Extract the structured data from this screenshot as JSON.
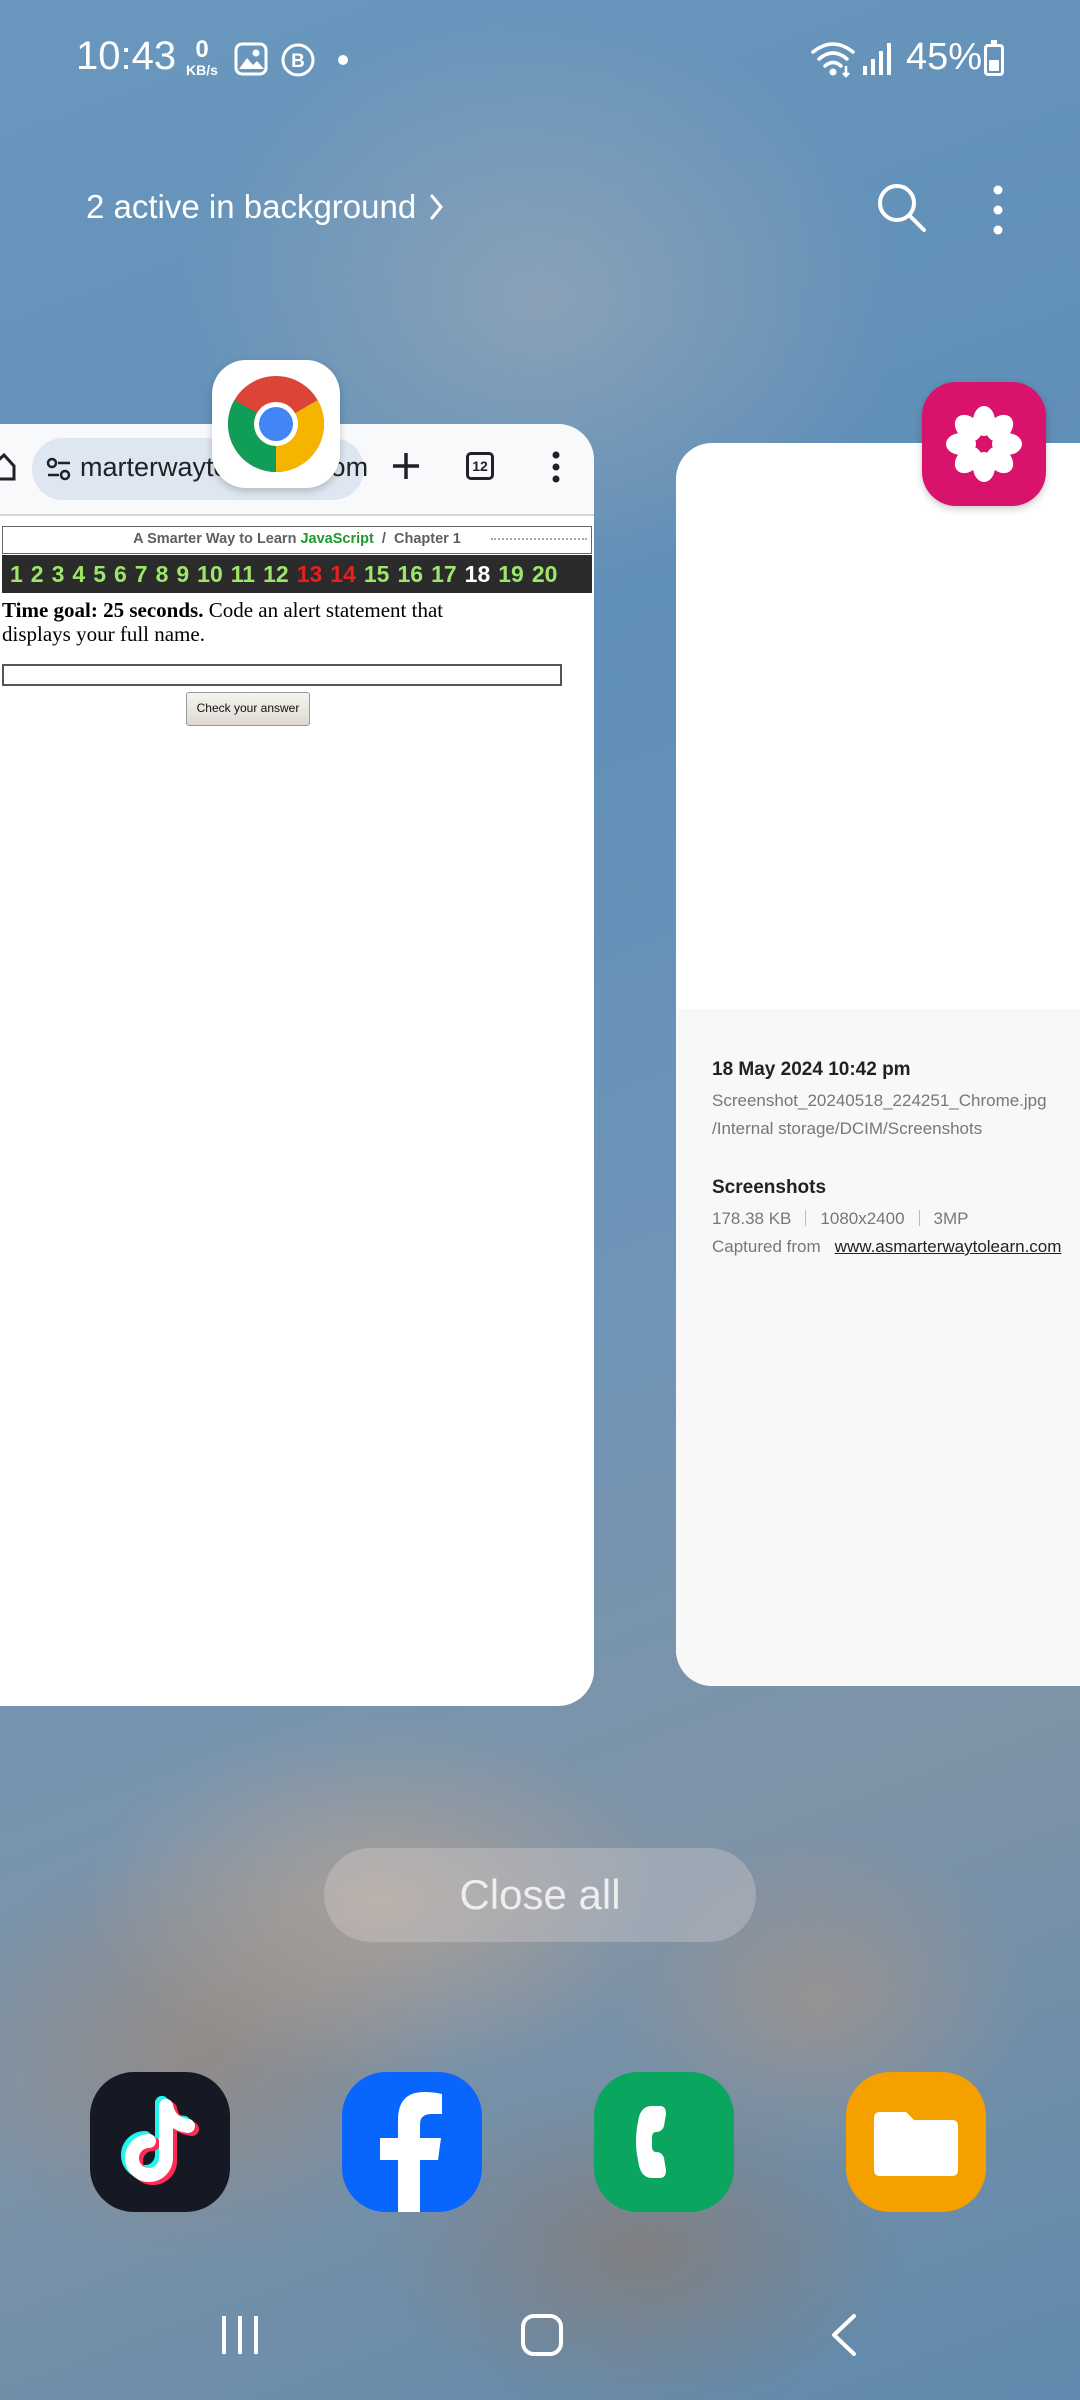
{
  "status_bar": {
    "time": "10:43",
    "net_speed_value": "0",
    "net_speed_unit": "KB/s",
    "battery": "45%",
    "icons": [
      "image-notification-icon",
      "b-notification-icon",
      "dot-icon",
      "wifi-icon",
      "signal-icon",
      "battery-icon"
    ]
  },
  "header": {
    "active_background": "2 active in background",
    "icons": [
      "chevron-right-icon",
      "search-icon",
      "more-options-icon"
    ]
  },
  "recents": {
    "chrome_card": {
      "app": "Chrome",
      "url": "marterwayto",
      "url_tail": "om",
      "tab_count": "12",
      "book_title_prefix": "A Smarter Way to Learn",
      "book_title_js": "JavaScript",
      "book_title_sep": "/",
      "book_chapter": "Chapter 1",
      "chapters": [
        {
          "n": "1",
          "state": "done"
        },
        {
          "n": "2",
          "state": "done"
        },
        {
          "n": "3",
          "state": "done"
        },
        {
          "n": "4",
          "state": "done"
        },
        {
          "n": "5",
          "state": "done"
        },
        {
          "n": "6",
          "state": "done"
        },
        {
          "n": "7",
          "state": "done"
        },
        {
          "n": "8",
          "state": "done"
        },
        {
          "n": "9",
          "state": "done"
        },
        {
          "n": "10",
          "state": "done"
        },
        {
          "n": "11",
          "state": "done"
        },
        {
          "n": "12",
          "state": "done"
        },
        {
          "n": "13",
          "state": "error"
        },
        {
          "n": "14",
          "state": "error"
        },
        {
          "n": "15",
          "state": "done"
        },
        {
          "n": "16",
          "state": "done"
        },
        {
          "n": "17",
          "state": "done"
        },
        {
          "n": "18",
          "state": "current"
        },
        {
          "n": "19",
          "state": "done"
        },
        {
          "n": "20",
          "state": "done"
        }
      ],
      "time_goal": "Time goal: 25 seconds.",
      "instruction": "Code an alert statement that displays your full name.",
      "check_button": "Check your answer"
    },
    "gallery_card": {
      "app": "Gallery",
      "date": "18 May 2024 10:42 pm",
      "file_name": "Screenshot_20240518_224251_Chrome.jpg",
      "path": "/Internal storage/DCIM/Screenshots",
      "album": "Screenshots",
      "size": "178.38 KB",
      "resolution": "1080x2400",
      "megapixels": "3MP",
      "captured_from_label": "Captured from",
      "captured_from_url": "www.asmarterwaytolearn.com"
    },
    "close_all": "Close all"
  },
  "dock": {
    "apps": [
      "TikTok",
      "Facebook",
      "Phone",
      "My Files"
    ]
  },
  "colors": {
    "chapter_done": "#9ee66a",
    "chapter_error": "#e62020",
    "chapter_current": "#ffffff",
    "js_green": "#1d9a2c",
    "gallery_pink": "#d9126c"
  }
}
